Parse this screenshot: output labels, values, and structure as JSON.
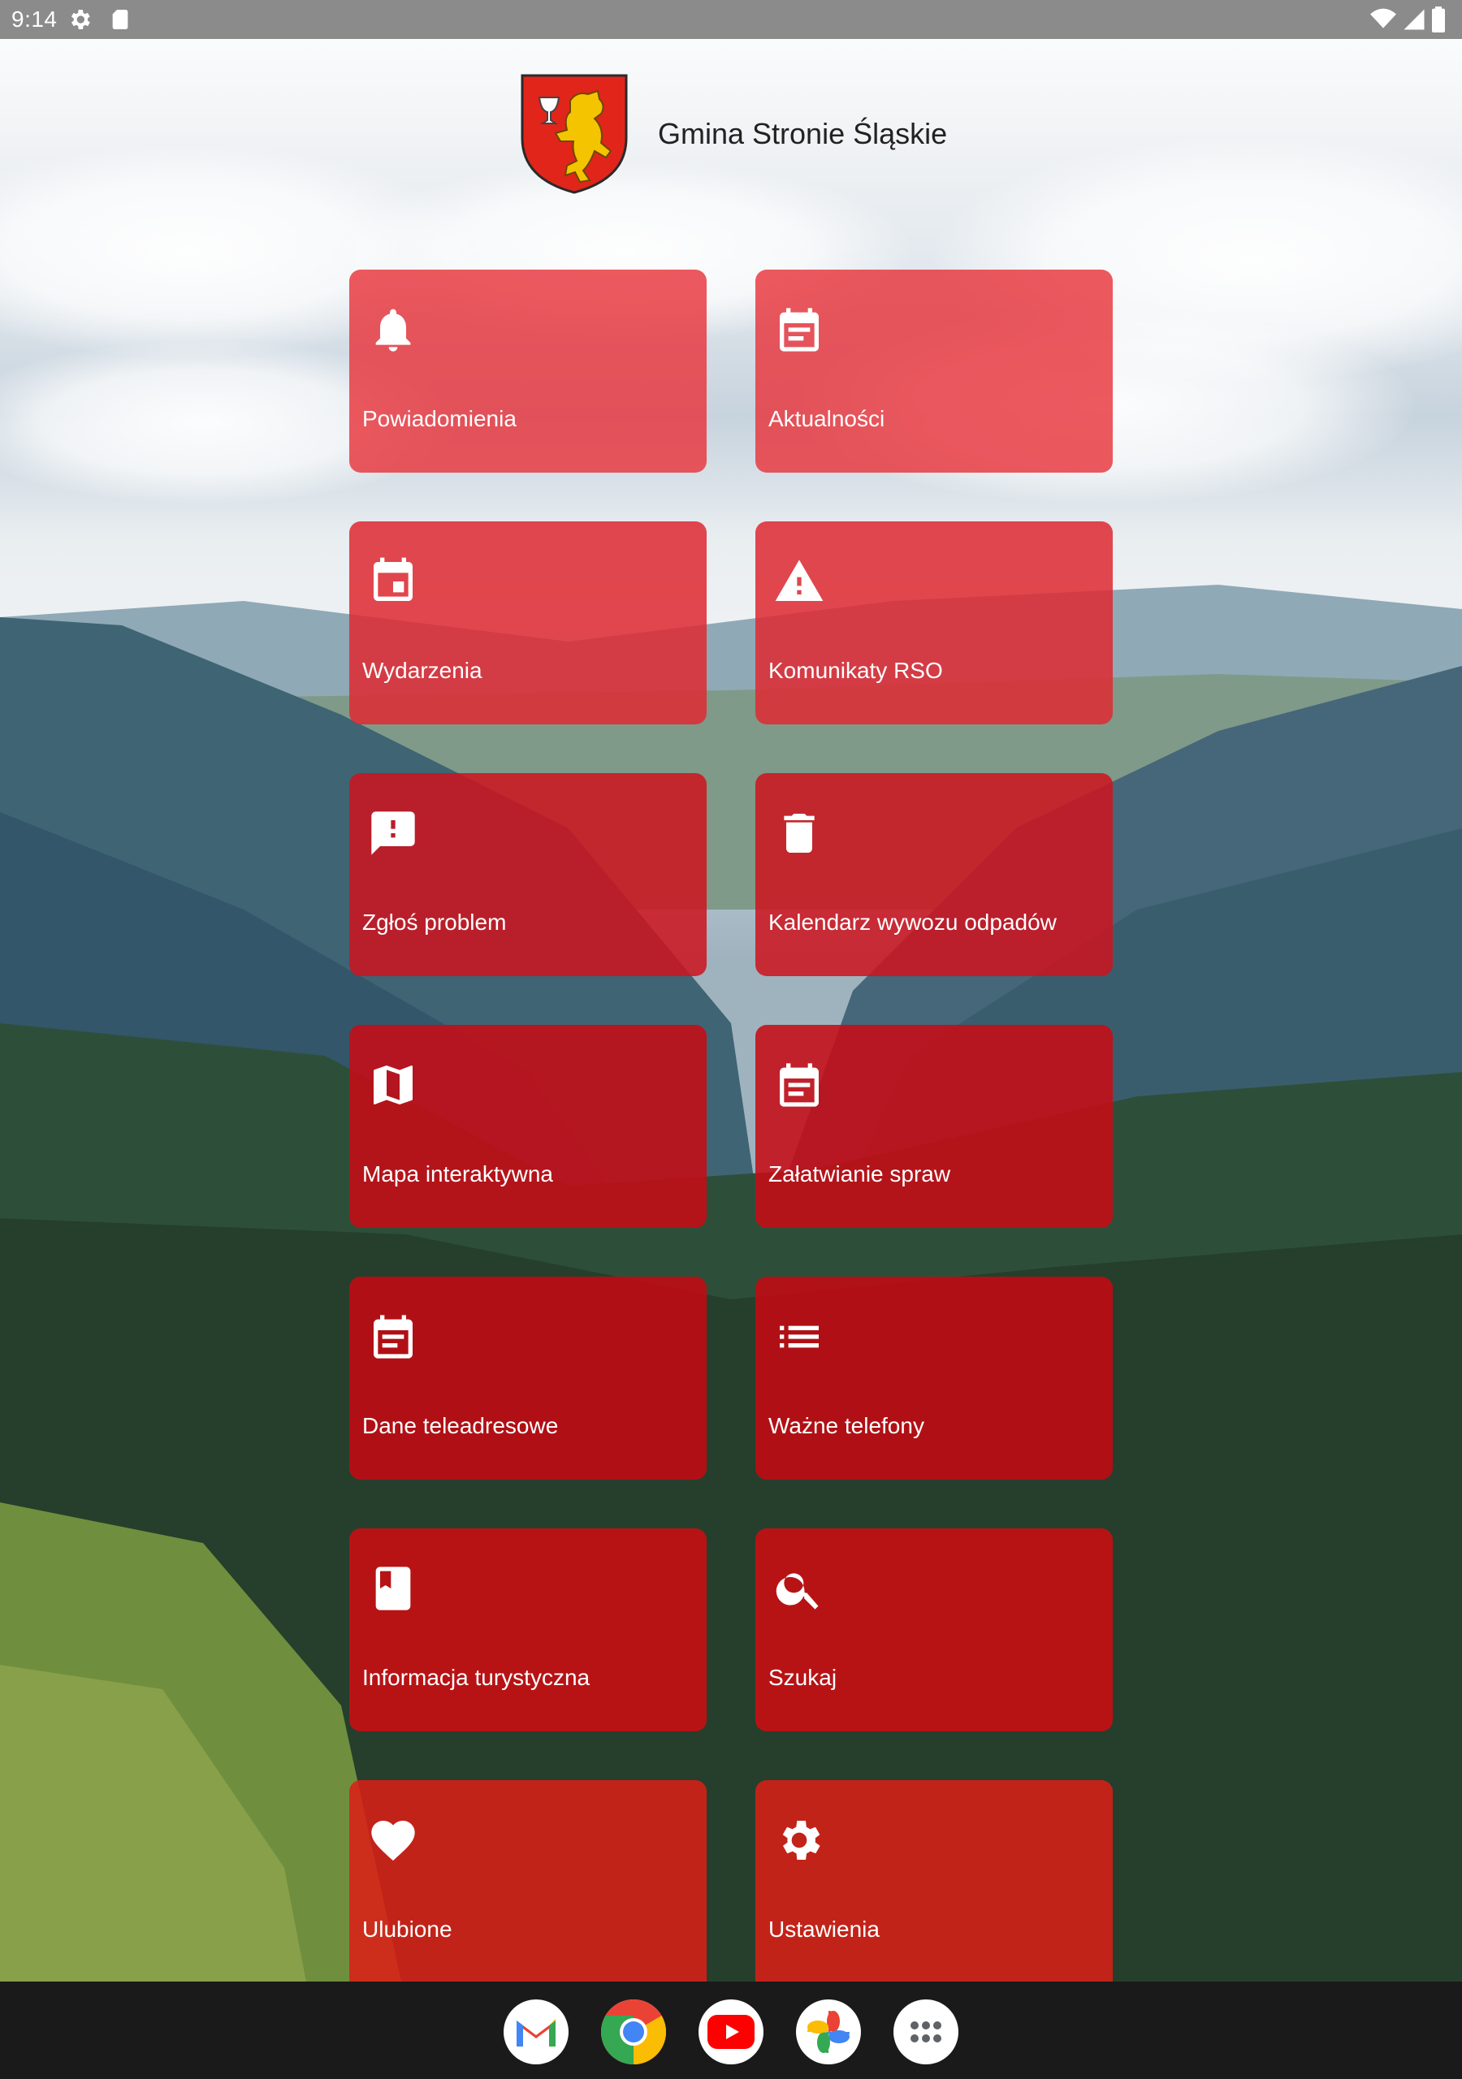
{
  "status_bar": {
    "time": "9:14",
    "left_icons": [
      "settings-gear-icon",
      "sd-card-icon"
    ],
    "right_icons": [
      "wifi-icon",
      "cell-signal-icon",
      "battery-icon"
    ]
  },
  "header": {
    "title": "Gmina Stronie Śląskie",
    "crest": "coat-of-arms-bear-icon"
  },
  "tiles": [
    {
      "label": "Powiadomienia",
      "icon": "bell-icon"
    },
    {
      "label": "Aktualności",
      "icon": "news-calendar-icon"
    },
    {
      "label": "Wydarzenia",
      "icon": "event-calendar-icon"
    },
    {
      "label": "Komunikaty RSO",
      "icon": "warning-icon"
    },
    {
      "label": "Zgłoś problem",
      "icon": "report-problem-icon"
    },
    {
      "label": "Kalendarz wywozu odpadów",
      "icon": "trash-icon"
    },
    {
      "label": "Mapa interaktywna",
      "icon": "map-icon"
    },
    {
      "label": "Załatwianie spraw",
      "icon": "document-calendar-icon"
    },
    {
      "label": "Dane teleadresowe",
      "icon": "contact-calendar-icon"
    },
    {
      "label": "Ważne telefony",
      "icon": "list-icon"
    },
    {
      "label": "Informacja turystyczna",
      "icon": "book-icon"
    },
    {
      "label": "Szukaj",
      "icon": "search-icon"
    },
    {
      "label": "Ulubione",
      "icon": "heart-icon"
    },
    {
      "label": "Ustawienia",
      "icon": "gear-icon"
    }
  ],
  "dock": {
    "apps": [
      "gmail-icon",
      "chrome-icon",
      "youtube-icon",
      "photos-icon",
      "app-drawer-icon"
    ]
  },
  "colors": {
    "tile_red": "#d92a32",
    "status_bar": "#8b8b8b",
    "dock": "#1a1a1a",
    "crest_red": "#e1251b",
    "crest_yellow": "#f5c400"
  }
}
